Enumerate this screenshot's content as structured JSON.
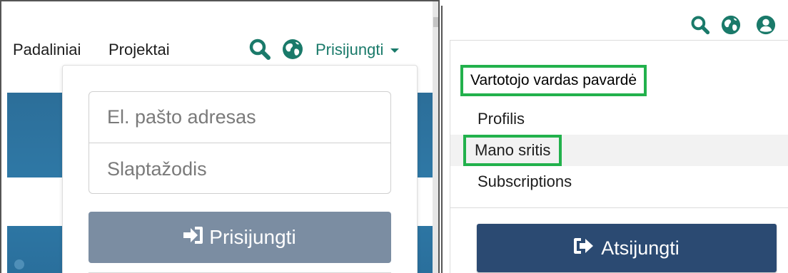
{
  "left": {
    "nav": {
      "padaliniai": "Padaliniai",
      "projektai": "Projektai",
      "login": "Prisijungti",
      "search_icon": "search-icon",
      "globe_icon": "globe-icon"
    },
    "login_form": {
      "email_placeholder": "El. pašto adresas",
      "password_placeholder": "Slaptažodis",
      "submit_label": "Prisijungti",
      "submit_icon": "sign-in-icon"
    }
  },
  "right": {
    "topbar": {
      "search_icon": "search-icon",
      "globe_icon": "globe-icon",
      "user_icon": "user-circle-icon"
    },
    "user_menu": {
      "username": "Vartotojo vardas pavardė",
      "items": [
        "Profilis",
        "Mano sritis",
        "Subscriptions"
      ],
      "logout_label": "Atsijungti",
      "logout_icon": "sign-out-icon"
    }
  },
  "colors": {
    "brand_teal": "#1a7a6a",
    "highlight_green": "#22b14c",
    "login_button": "#7b8da2",
    "logout_button": "#2b4a72",
    "banner_blue": "#2f7aa8"
  }
}
